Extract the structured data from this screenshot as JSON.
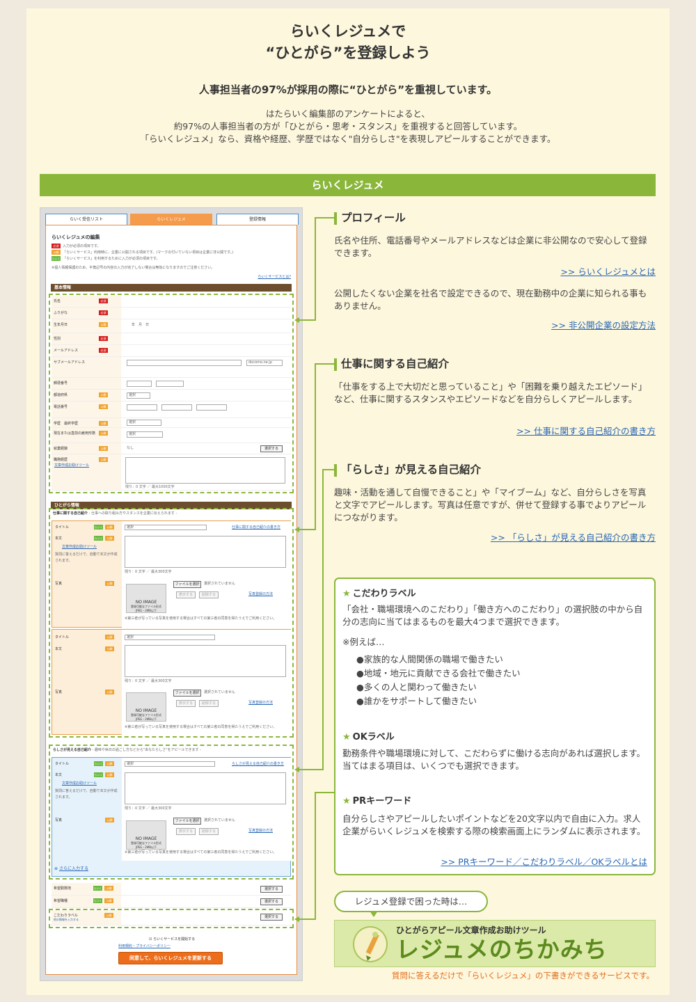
{
  "header": {
    "title_line1": "らいくレジュメで",
    "title_line2": "“ひとがら”を登録しよう",
    "subtitle": "人事担当者の97%が採用の際に“ひとがら”を重視しています。",
    "desc1": "はたらいく編集部のアンケートによると、",
    "desc2": "約97%の人事担当者の方が「ひとがら・思考・スタンス」を重視すると回答しています。",
    "desc3": "「らいくレジュメ」なら、資格や経歴、学歴ではなく\"自分らしさ\"を表現しアピールすることができます。"
  },
  "section_bar": "らいくレジュメ",
  "form": {
    "tabs": [
      "らいく受信リスト",
      "らいくレジュメ",
      "登録情報"
    ],
    "edit_title": "らいくレジュメの編集",
    "legend1": "入力が必須の項目です。",
    "legend2": "「らいくサービス」利用時に、企業に公開される項目です。(マークの付いていない項目は企業に非公開です。)",
    "legend3": "「らいくサービス」を利用するために入力が必須の項目です。",
    "legend_note": "※個人情報保護のため、半角記号の内容の入力が完了しない場合は無効になりますのでご注意ください。",
    "help_link": "らいくサービスとは?",
    "badge_required": "必須",
    "badge_public": "公開",
    "badge_like": "らいく",
    "basic_header": "基本情報",
    "basic_rows": [
      "氏名",
      "ふりがな",
      "生年月日",
      "性別",
      "メールアドレス",
      "サブメールアドレス",
      "郵便番号",
      "都道府県",
      "電話番号",
      "学歴　最終学歴",
      "現在または直前の雇用形態",
      "就業経験",
      "職務経歴"
    ],
    "birth_placeholder": "年　月　日",
    "mail_domain": "docomo.ne.jp",
    "select_default": "選択",
    "none_text": "なし",
    "select_button": "選択する",
    "char_count": "残り：0 文字 ／ 最大1000文字",
    "char_count_small": "残り：0 文字 ／ 最大300文字",
    "person_header": "ひとがら情報",
    "work_intro": "仕事に関する自己紹介",
    "work_intro_note": "- 仕事への取り組み方やスタンスを企業に伝えられます -",
    "rashisa_intro": "らしさが見える自己紹介",
    "rashisa_note": "- 趣味や休日の過ごし方などから\"あなたらしさ\"をアピールできます -",
    "label_title": "タイトル",
    "label_body": "本文",
    "label_photo": "写真",
    "writing_tool": "文章作成お助けツール",
    "writing_tool_desc": "質問に答えるだけで、自動で本文が作成されます。",
    "file_button": "ファイルを選択",
    "file_none": "選択されていません",
    "display_button": "表示する",
    "delete_button": "削除する",
    "photo_link": "写真登録の方法",
    "photo_note": "※第三者が写っている写真を使用する場合はすべての第三者の同意を得たうえでご利用ください。",
    "no_image": "NO IMAGE",
    "no_image_sub": "登録可能なファイル形式 JPEG・2MB以下",
    "write_link": "仕事に関する自己紹介の書き方",
    "rashisa_link": "らしさが見える自己紹介の書き方",
    "add_more": "さらに入力する",
    "bottom_rows": [
      "希望勤務地",
      "希望職種",
      "こだわりラベル"
    ],
    "kodawari_note": "他の情報を入力する",
    "agree_check": "らいくサービスを開始する",
    "terms": "利用規約・プライバシーポリシー",
    "submit": "同意して、らいくレジュメを更新する"
  },
  "right": {
    "profile_title": "プロフィール",
    "profile_text": "氏名や住所、電話番号やメールアドレスなどは企業に非公開なので安心して登録できます。",
    "profile_link": ">> らいくレジュメとは",
    "private_text": "公開したくない企業を社名で設定できるので、現在勤務中の企業に知られる事もありません。",
    "private_link": ">> 非公開企業の設定方法",
    "work_title": "仕事に関する自己紹介",
    "work_text": "「仕事をする上で大切だと思っていること」や「困難を乗り越えたエピソード」など、仕事に関するスタンスやエピソードなどを自分らしくアピールします。",
    "work_link": ">> 仕事に関する自己紹介の書き方",
    "rashisa_title": "「らしさ」が見える自己紹介",
    "rashisa_text": "趣味・活動を通して自慢できること」や「マイブーム」など、自分らしさを写真と文字でアピールします。写真は任意ですが、併せて登録する事でよりアピールにつながります。",
    "rashisa_link": ">> 「らしさ」が見える自己紹介の書き方"
  },
  "labels_box": {
    "kodawari_title": "こだわりラベル",
    "kodawari_text": "「会社・職場環境へのこだわり」「働き方へのこだわり」の選択肢の中から自分の志向に当てはまるものを最大4つまで選択できます。",
    "example_head": "※例えば…",
    "examples": [
      "●家族的な人間関係の職場で働きたい",
      "●地域・地元に貢献できる会社で働きたい",
      "●多くの人と関わって働きたい",
      "●誰かをサポートして働きたい"
    ],
    "ok_title": "OKラベル",
    "ok_text": "勤務条件や職場環境に対して、こだわらずに働ける志向があれば選択します。当てはまる項目は、いくつでも選択できます。",
    "pr_title": "PRキーワード",
    "pr_text": "自分らしさやアピールしたいポイントなどを20文字以内で自由に入力。求人企業がらいくレジュメを検索する際の検索画面上にランダムに表示されます。",
    "pr_link": ">> PRキーワード／こだわりラベル／OKラベルとは"
  },
  "help": {
    "pill": "レジュメ登録で困った時は…",
    "banner_small": "ひとがらアピール文章作成お助けツール",
    "banner_large": "レジュメのちかみち",
    "caption": "質問に答えるだけで「らいくレジュメ」の下書きができるサービスです。"
  },
  "colors": {
    "accent_green": "#8ab63a",
    "brand_orange": "#ec6d1b",
    "link_blue": "#2766b5",
    "panel_bg": "#fdf7dd"
  }
}
